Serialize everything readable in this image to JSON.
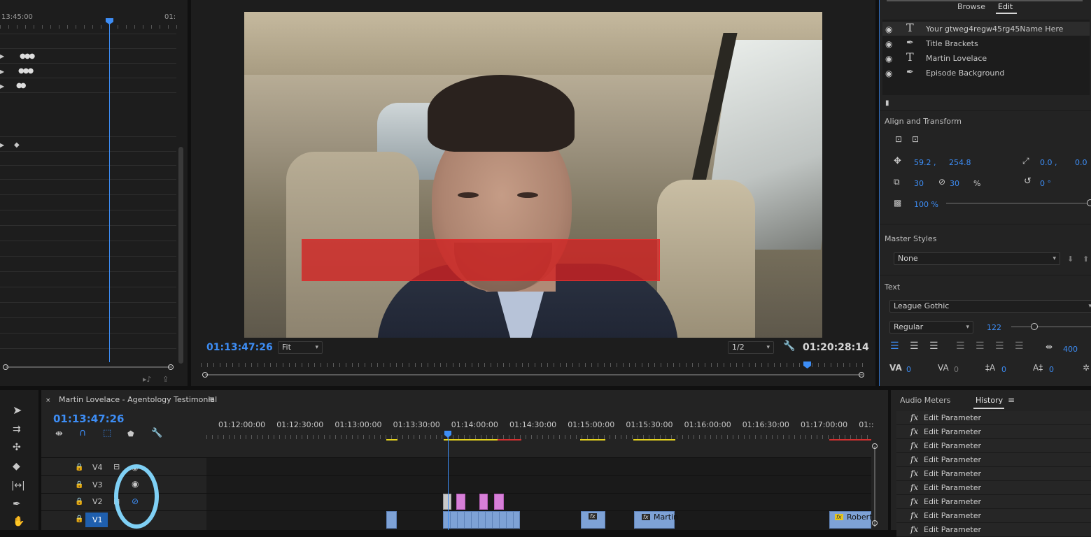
{
  "source_monitor": {
    "ruler_left": "13:45:00",
    "ruler_right": "01:"
  },
  "program_monitor": {
    "timecode_left": "01:13:47:26",
    "fit_label": "Fit",
    "resolution": "1/2",
    "timecode_right": "01:20:28:14"
  },
  "essential_graphics": {
    "tabs": [
      "Browse",
      "Edit"
    ],
    "layers": [
      {
        "type": "text",
        "label": "Your gtweg4regw45rg45Name Here"
      },
      {
        "type": "shape",
        "label": "Title Brackets"
      },
      {
        "type": "text",
        "label": "Martin Lovelace"
      },
      {
        "type": "shape",
        "label": "Episode Background"
      }
    ],
    "align_transform_label": "Align and Transform",
    "position_x": "59.2 ,",
    "position_y": "254.8",
    "anchor_x": "0.0 ,",
    "anchor_y": "0.0",
    "scale_w": "30",
    "scale_h": "30",
    "scale_unit": "%",
    "rotation": "0 °",
    "opacity": "100 %",
    "master_styles_label": "Master Styles",
    "master_style_value": "None",
    "text_label": "Text",
    "font_family": "League Gothic",
    "font_style": "Regular",
    "font_size": "122",
    "tracking": "400",
    "kerning": "0",
    "leading": "0",
    "baseline": "0",
    "tsume": "0"
  },
  "timeline": {
    "sequence_name": "Martin Lovelace - Agentology Testimonial",
    "timecode": "01:13:47:26",
    "ruler_labels": [
      "01:12:00:00",
      "01:12:30:00",
      "01:13:00:00",
      "01:13:30:00",
      "01:14:00:00",
      "01:14:30:00",
      "01:15:00:00",
      "01:15:30:00",
      "01:16:00:00",
      "01:16:30:00",
      "01:17:00:00",
      "01::"
    ],
    "tracks": [
      "V4",
      "V3",
      "V2",
      "V1"
    ],
    "clip_label_martin": "Martin",
    "clip_label_robert": "Robert",
    "fx_badge": "fx"
  },
  "history_panel": {
    "tabs": [
      "Audio Meters",
      "History"
    ],
    "items": [
      "Edit Parameter",
      "Edit Parameter",
      "Edit Parameter",
      "Edit Parameter",
      "Edit Parameter",
      "Edit Parameter",
      "Edit Parameter",
      "Edit Parameter",
      "Edit Parameter"
    ],
    "fx_badge": "fx"
  },
  "colors": {
    "accent_blue": "#3d8df5",
    "clip_blue": "#7ea2d6",
    "clip_pink": "#d77fd8",
    "annotation_circle": "#7fd0f5",
    "red_bar": "#d22020"
  }
}
